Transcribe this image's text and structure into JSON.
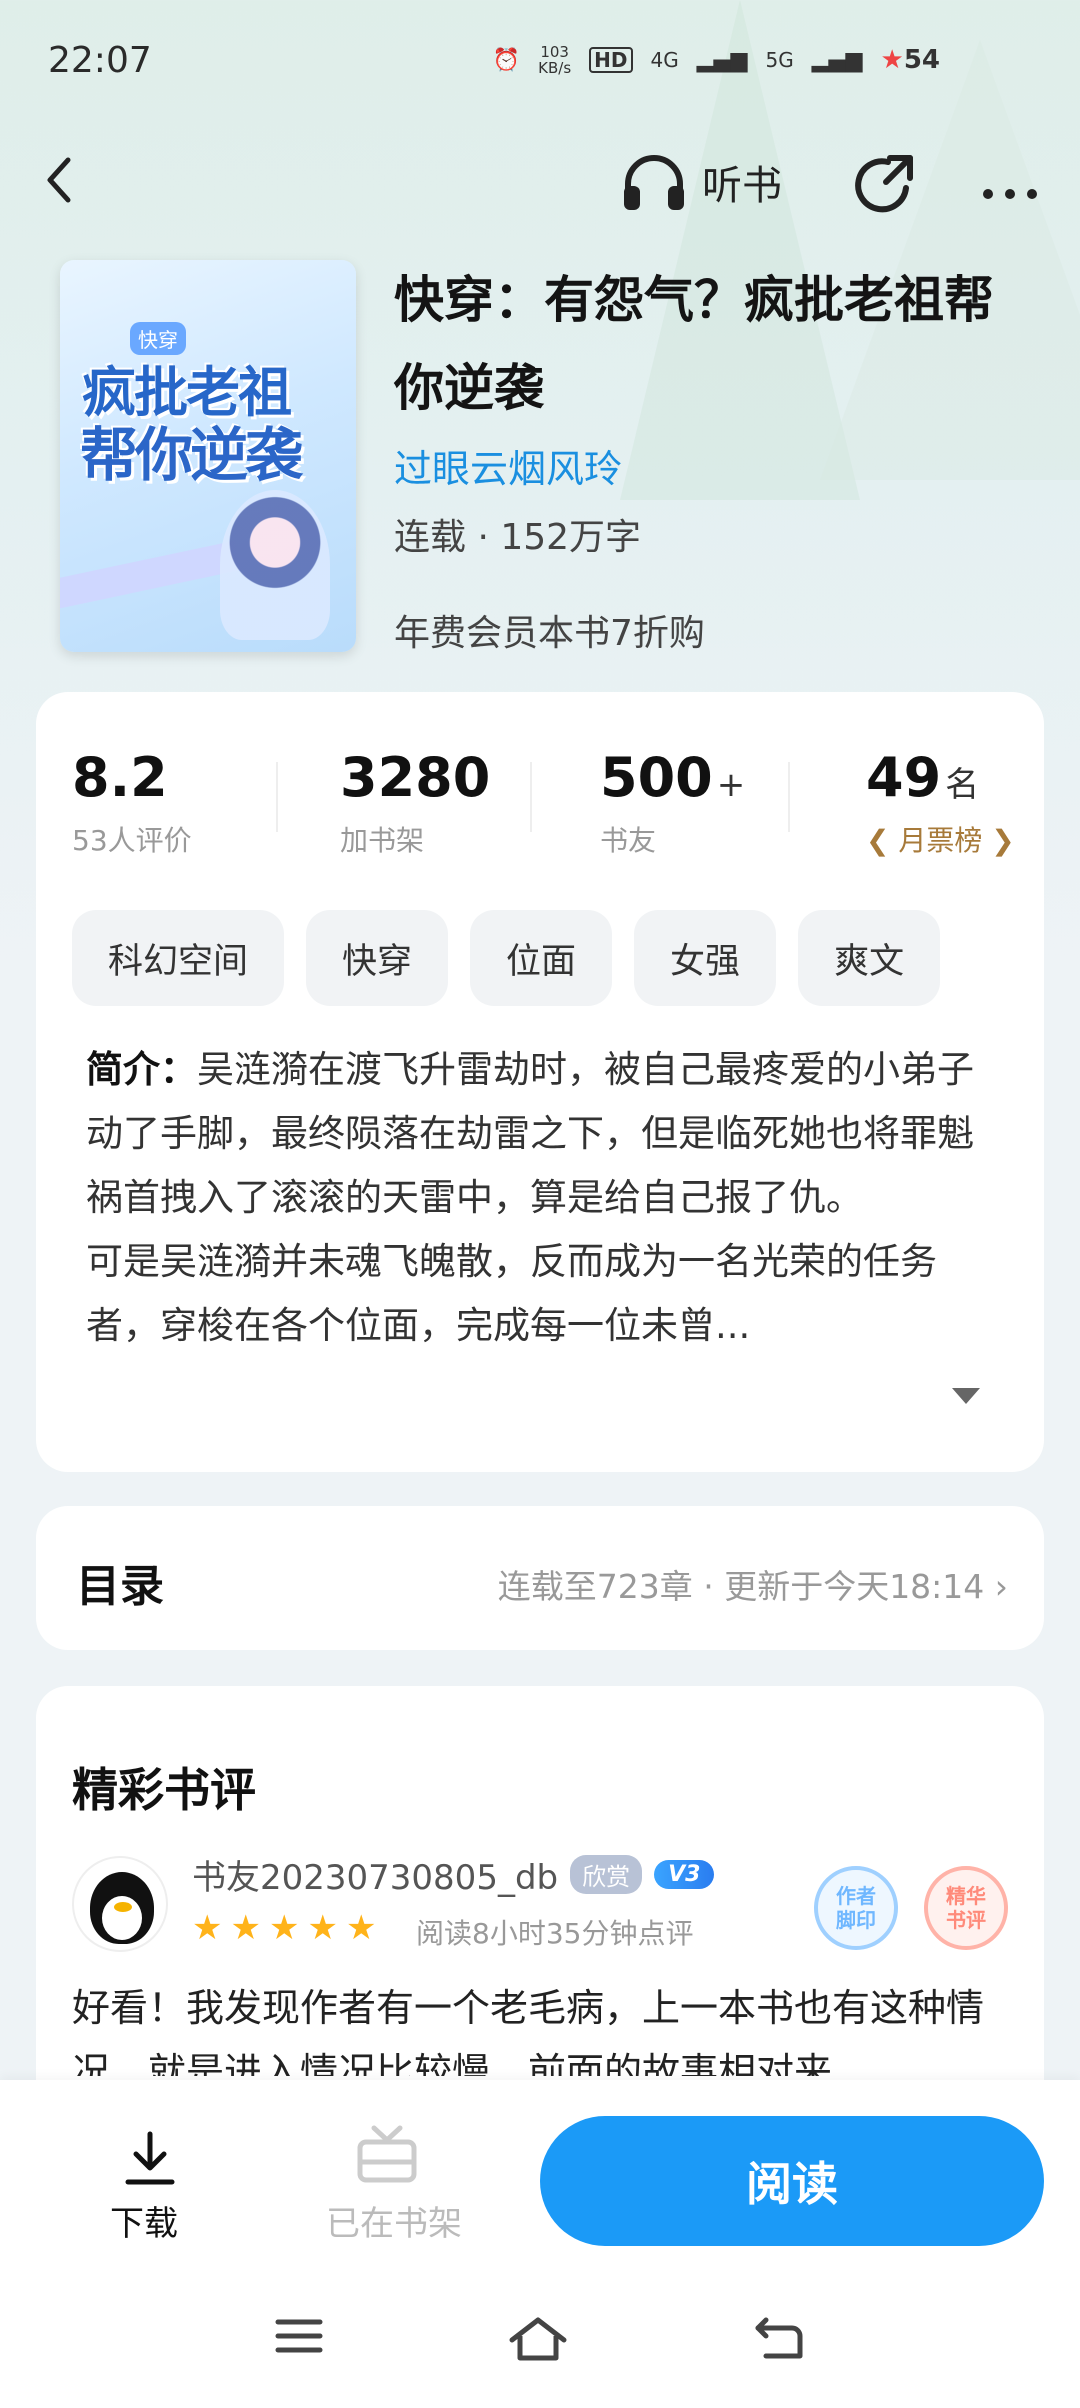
{
  "status_bar": {
    "time": "22:07",
    "net_speed": "103\nKB/s",
    "net_speed_value": "103",
    "net_speed_unit": "KB/s",
    "hd": "HD",
    "signal_4g": "4G",
    "signal_5g": "5G",
    "battery": "54"
  },
  "header": {
    "listen_label": "听书"
  },
  "book": {
    "title": "快穿：有怨气？疯批老祖帮你逆袭",
    "author": "过眼云烟风玲",
    "meta": "连载 · 152万字",
    "promo": "年费会员本书7折购",
    "cover": {
      "tag": "快穿",
      "line1": "疯批老祖",
      "line2": "帮你逆袭"
    }
  },
  "stats": [
    {
      "value": "8.2",
      "suffix": "",
      "label": "53人评价"
    },
    {
      "value": "3280",
      "suffix": "",
      "label": "加书架"
    },
    {
      "value": "500",
      "suffix": "+",
      "label": "书友"
    },
    {
      "value": "49",
      "suffix": "名",
      "label": "月票榜"
    }
  ],
  "tags": [
    "科幻空间",
    "快穿",
    "位面",
    "女强",
    "爽文"
  ],
  "intro": {
    "label": "简介：",
    "text": "吴涟漪在渡飞升雷劫时，被自己最疼爱的小弟子动了手脚，最终陨落在劫雷之下，但是临死她也将罪魁祸首拽入了滚滚的天雷中，算是给自己报了仇。",
    "text2": "可是吴涟漪并未魂飞魄散，反而成为一名光荣的任务者，穿梭在各个位面，完成每一位未曾..."
  },
  "toc": {
    "title": "目录",
    "info": "连载至723章 · 更新于今天18:14"
  },
  "reviews": {
    "title": "精彩书评",
    "items": [
      {
        "user": "书友20230730805_db",
        "badge": "欣赏",
        "level": "V3",
        "rating": 5,
        "read_info": "阅读8小时35分钟点评",
        "seal1": "作者\n脚印",
        "seal2": "精华\n书评",
        "text": "好看！我发现作者有一个老毛病，上一本书也有这种情况，就是进入情况比较慢，前面的故事相对来"
      }
    ]
  },
  "bottom": {
    "download_label": "下载",
    "shelf_label": "已在书架",
    "read_label": "阅读"
  }
}
